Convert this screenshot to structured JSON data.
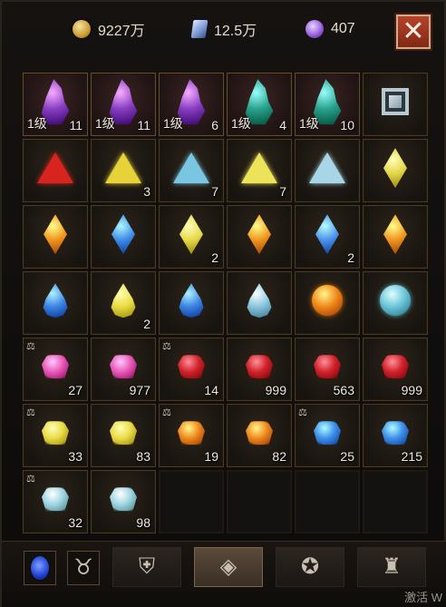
{
  "header": {
    "gold": "9227万",
    "shards": "12.5万",
    "orbs": "407",
    "close_icon": "✕"
  },
  "slots": [
    {
      "shape": "crys",
      "color": "#8a3fc2",
      "level": "1级",
      "count": "11"
    },
    {
      "shape": "crys",
      "color": "#8a3fc2",
      "level": "1级",
      "count": "11"
    },
    {
      "shape": "crys",
      "color": "#8a3fc2",
      "level": "1级",
      "count": "6"
    },
    {
      "shape": "crys",
      "color": "#2aa38e",
      "level": "1级",
      "count": "4"
    },
    {
      "shape": "crys",
      "color": "#2aa38e",
      "level": "1级",
      "count": "10"
    },
    {
      "shape": "frame",
      "color": "#b9c9d2",
      "level": "",
      "count": ""
    },
    {
      "shape": "tri",
      "color": "#d8241e",
      "count": ""
    },
    {
      "shape": "tri",
      "color": "#e8d23a",
      "count": "3"
    },
    {
      "shape": "tri",
      "color": "#78c6e2",
      "count": "7"
    },
    {
      "shape": "tri",
      "color": "#ece35a",
      "count": "7"
    },
    {
      "shape": "tri",
      "color": "#a9d6e6",
      "count": ""
    },
    {
      "shape": "marq",
      "color": "#e3d64a",
      "count": ""
    },
    {
      "shape": "marq",
      "color": "#f0951e",
      "count": ""
    },
    {
      "shape": "marq",
      "color": "#3f8bea",
      "count": ""
    },
    {
      "shape": "marq",
      "color": "#e6d84a",
      "count": "2"
    },
    {
      "shape": "marq",
      "color": "#f0951e",
      "count": ""
    },
    {
      "shape": "marq",
      "color": "#4a92ec",
      "count": "2"
    },
    {
      "shape": "marq",
      "color": "#f0951e",
      "count": ""
    },
    {
      "shape": "drop",
      "color": "#3f86e6",
      "count": ""
    },
    {
      "shape": "drop",
      "color": "#ecdd46",
      "count": "2"
    },
    {
      "shape": "drop",
      "color": "#3f86e6",
      "count": ""
    },
    {
      "shape": "drop",
      "color": "#8cc8e0",
      "count": ""
    },
    {
      "shape": "sphere",
      "color": "#f0891a",
      "count": ""
    },
    {
      "shape": "sphere",
      "color": "#6fc6d8",
      "count": ""
    },
    {
      "shape": "rough",
      "color": "#e85ab8",
      "count": "27",
      "scale": true
    },
    {
      "shape": "rough",
      "color": "#e85ab8",
      "count": "977"
    },
    {
      "shape": "rough",
      "color": "#d0222c",
      "count": "14",
      "scale": true
    },
    {
      "shape": "rough",
      "color": "#d0222c",
      "count": "999"
    },
    {
      "shape": "rough",
      "color": "#d0222c",
      "count": "563"
    },
    {
      "shape": "rough",
      "color": "#d0222c",
      "count": "999"
    },
    {
      "shape": "rough",
      "color": "#eadb48",
      "count": "33",
      "scale": true
    },
    {
      "shape": "rough",
      "color": "#eadb48",
      "count": "83"
    },
    {
      "shape": "rough",
      "color": "#ef8a1e",
      "count": "19",
      "scale": true
    },
    {
      "shape": "rough",
      "color": "#ef8a1e",
      "count": "82"
    },
    {
      "shape": "rough",
      "color": "#3f90ea",
      "count": "25",
      "scale": true
    },
    {
      "shape": "rough",
      "color": "#3f90ea",
      "count": "215"
    },
    {
      "shape": "rough",
      "color": "#9fd6e2",
      "count": "32",
      "scale": true
    },
    {
      "shape": "rough",
      "color": "#9fd6e2",
      "count": "98"
    }
  ],
  "scale_glyph": "⚖",
  "bottom": {
    "tabs": [
      {
        "name": "sapphire-tab-icon",
        "glyph": ""
      },
      {
        "name": "bull-mask-tab-icon",
        "glyph": "♉"
      },
      {
        "name": "helmet-tab-icon",
        "glyph": "⛨"
      },
      {
        "name": "gem-pouch-tab-icon",
        "glyph": "◈"
      },
      {
        "name": "rune-tab-icon",
        "glyph": "✪"
      },
      {
        "name": "loot-bag-tab-icon",
        "glyph": "♜"
      }
    ],
    "watermark": "激活 W"
  }
}
